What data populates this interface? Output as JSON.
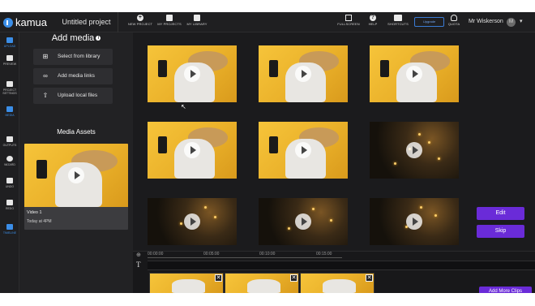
{
  "app": {
    "logo_text": "kamua",
    "project_title": "Untitled project"
  },
  "topbar": {
    "new_project": "NEW PROJECT",
    "my_projects": "MY PROJECTS",
    "my_library": "MY LIBRARY",
    "fullscreen": "FULLSCREEN",
    "help": "HELP",
    "shortcuts": "SHORTCUTS",
    "upgrade": "Upgrade",
    "quota": "QUOTA",
    "user_name": "Mr Wiskerson",
    "user_initial": "M"
  },
  "rail": {
    "items": [
      {
        "label": "UPLOAD"
      },
      {
        "label": "PREVIEW"
      },
      {
        "label": "PROJECT SETTINGS"
      },
      {
        "label": "MEDIA"
      },
      {
        "label": "OUTPUTS"
      },
      {
        "label": "WIZARD"
      },
      {
        "label": "UNDO"
      },
      {
        "label": "REDO"
      },
      {
        "label": "TIMELINE"
      }
    ]
  },
  "panel": {
    "title": "Add media",
    "select_library": "Select from library",
    "add_links": "Add media links",
    "upload_local": "Upload local files",
    "assets_heading": "Media Assets",
    "asset": {
      "name": "Video 1",
      "date": "Today at 4PM"
    }
  },
  "actions": {
    "edit": "Edit",
    "skip": "Skip",
    "add_more": "Add More Clips"
  },
  "timeline": {
    "ticks": [
      "00:00:00",
      "00:05:00",
      "00:10:00",
      "00:15:00"
    ],
    "text_track_icon": "T",
    "clip_close": "✕"
  },
  "colors": {
    "accent_blue": "#3b8ee8",
    "purple": "#6a2bd8"
  }
}
